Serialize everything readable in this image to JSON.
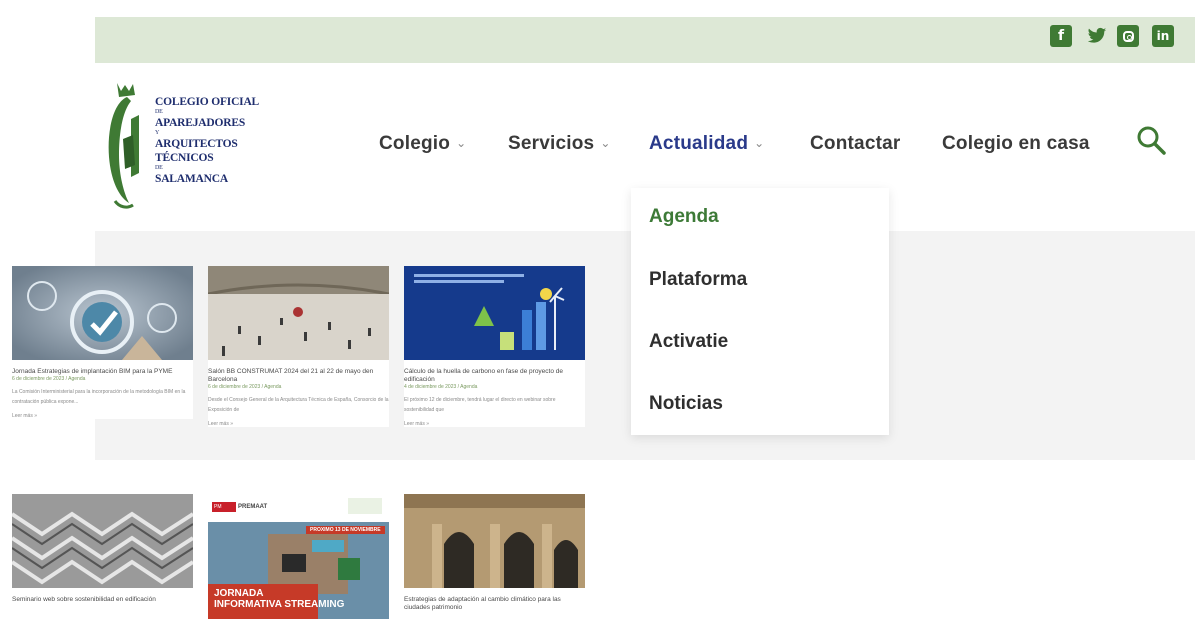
{
  "colors": {
    "green": "#3f7a34",
    "navy": "#1f2e6e",
    "active_nav": "#2a3a8a",
    "topbar_bg": "#dde8d6"
  },
  "social": [
    {
      "icon": "facebook-icon",
      "glyph": "f"
    },
    {
      "icon": "twitter-icon",
      "glyph": "🐦"
    },
    {
      "icon": "instagram-icon",
      "glyph": ""
    },
    {
      "icon": "linkedin-icon",
      "glyph": "in"
    }
  ],
  "logo": {
    "line1": "COLEGIO OFICIAL",
    "line2": "DE",
    "line3": "APAREJADORES",
    "line4": "Y",
    "line5": "ARQUITECTOS TÉCNICOS",
    "line6": "DE",
    "line7": "SALAMANCA"
  },
  "nav": {
    "items": [
      {
        "label": "Colegio",
        "has_chevron": true
      },
      {
        "label": "Servicios",
        "has_chevron": true
      },
      {
        "label": "Actualidad",
        "has_chevron": true,
        "active": true
      },
      {
        "label": "Contactar",
        "has_chevron": false
      },
      {
        "label": "Colegio en casa",
        "has_chevron": false
      }
    ],
    "chevron_glyph": "⌄",
    "search_icon": "search-icon"
  },
  "dropdown": {
    "items": [
      "Agenda",
      "Plataforma",
      "Activatie",
      "Noticias"
    ]
  },
  "cards": [
    {
      "title": "Jornada Estrategias de implantación BIM para la PYME",
      "meta": "6 de diciembre de 2023 / Agenda",
      "excerpt": "La Comisión Interministerial para la incorporación de la metodología BIM en la contratación pública expone...",
      "more": "Leer más »"
    },
    {
      "title": "Salón BB CONSTRUMAT 2024 del 21 al 22 de mayo den Barcelona",
      "meta": "6 de diciembre de 2023 / Agenda",
      "excerpt": "Desde el Consejo General de la Arquitectura Técnica de España, Consorcio de la Exposición de",
      "more": "Leer más »"
    },
    {
      "title": "Cálculo de la huella de carbono en fase de proyecto de edificación",
      "meta": "4 de diciembre de 2023 / Agenda",
      "excerpt": "El próximo 12 de diciembre, tendrá lugar el directo en webinar sobre sostenibilidad que",
      "more": "Leer más »"
    },
    {
      "title": "Seminario web sobre sostenibilidad en edificación",
      "meta": "",
      "excerpt": "",
      "more": ""
    },
    {
      "title": "",
      "meta": "",
      "excerpt": "",
      "more": "",
      "overlay_line1": "JORNADA",
      "overlay_line2": "INFORMATIVA STREAMING",
      "badge": "PREMAAT",
      "banner": "PROXIMO 13 DE NOVIEMBRE"
    },
    {
      "title": "Estrategias de adaptación al cambio climático para las ciudades patrimonio",
      "meta": "",
      "excerpt": "",
      "more": ""
    }
  ]
}
